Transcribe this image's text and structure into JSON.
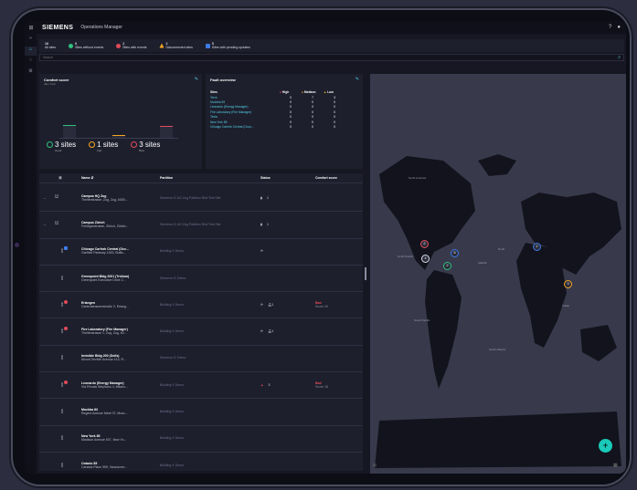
{
  "header": {
    "brand": "SIEMENS",
    "app_title": "Operations Manager"
  },
  "summary": [
    {
      "count": "16",
      "label": "All sites",
      "color": "#dcdcea",
      "icon": "all"
    },
    {
      "count": "6",
      "label": "Sites without events",
      "color": "#2ec27e",
      "icon": "check"
    },
    {
      "count": "2",
      "label": "Sites with events",
      "color": "#e14b5a",
      "icon": "alert"
    },
    {
      "count": "2",
      "label": "Disconnected sites",
      "color": "#f5a623",
      "icon": "warn"
    },
    {
      "count": "5",
      "label": "Sites with pending updates",
      "color": "#3f7be8",
      "icon": "update"
    }
  ],
  "search": {
    "placeholder": "Search"
  },
  "comfort": {
    "title": "Comfort score",
    "subtitle": "Jan / Feb",
    "kpis": [
      {
        "value": "3 sites",
        "label": "Good",
        "color": "#2ec27e",
        "level": 0.55
      },
      {
        "value": "1 sites",
        "label": "Fair",
        "color": "#f5a623",
        "level": 0.1
      },
      {
        "value": "3 sites",
        "label": "Bad",
        "color": "#e14b5a",
        "level": 0.5
      }
    ]
  },
  "fault": {
    "title": "Fault overview",
    "col_sites": "Sites",
    "col_high": "High",
    "col_medium": "Medium",
    "col_low": "Low",
    "rows": [
      {
        "site": "Terra",
        "high": "0",
        "medium": "7",
        "low": "3"
      },
      {
        "site": "Mockba 83",
        "high": "0",
        "medium": "0",
        "low": "0"
      },
      {
        "site": "Leonardo (Energy Manager)",
        "high": "0",
        "medium": "0",
        "low": "0"
      },
      {
        "site": "Fire Laboratory (Fire Manager)",
        "high": "0",
        "medium": "0",
        "low": "0"
      },
      {
        "site": "Tesla",
        "high": "0",
        "medium": "0",
        "low": "0"
      },
      {
        "site": "New York 85",
        "high": "0",
        "medium": "0",
        "low": "0"
      },
      {
        "site": "Chicago Carfork Central (Occu...",
        "high": "0",
        "medium": "0",
        "low": "0"
      }
    ]
  },
  "table": {
    "col_name": "Name",
    "col_partition": "Partition",
    "col_status": "Status",
    "col_comfort": "Comfort score",
    "rows": [
      {
        "name": "Campus HQ Zug",
        "addr": "Theilerstrasse, Zug, Zug, 6300...",
        "partition": "Siemens IC AG Zug Partition Red Test Site",
        "status": "1",
        "comfort": "",
        "comfort_sub": "",
        "badge": ""
      },
      {
        "name": "Campus Zürich",
        "addr": "Freilagerstrasse, Zürich, Zürich...",
        "partition": "Siemens IC AG Zug Partition Red Test Site",
        "status": "1",
        "comfort": "",
        "comfort_sub": "",
        "badge": ""
      },
      {
        "name": "Chicago Carfork Central (Occ...",
        "addr": "Garfield Parkway 1000, Buffa...",
        "partition": "Building X Demo",
        "status": "sync",
        "comfort": "",
        "comfort_sub": "",
        "badge": "blue"
      },
      {
        "name": "Greenpoint Bldg 2001 (Tridium)",
        "addr": "Greenpoint Executive Drive 2...",
        "partition": "Siemens IC Demo",
        "status": "",
        "comfort": "",
        "comfort_sub": "",
        "badge": ""
      },
      {
        "name": "Erlangen",
        "addr": "Gartenstrassenstraße 2, Erlang...",
        "partition": "Building X Demo",
        "status": "sync  1",
        "comfort": "Bad",
        "comfort_sub": "Score 20",
        "badge": "red"
      },
      {
        "name": "Fire Laboratory (Fire Manager)",
        "addr": "Theilerstrasse 1, Zug, Zug, 63...",
        "partition": "Building X Demo",
        "status": "sync  1",
        "comfort": "",
        "comfort_sub": "",
        "badge": "red"
      },
      {
        "name": "Invisible Bldg 200 (Dolls)",
        "addr": "Mount Terrible Avenue 413, R...",
        "partition": "Siemens IC Demo",
        "status": "",
        "comfort": "",
        "comfort_sub": "",
        "badge": ""
      },
      {
        "name": "Leonardo (Energy Manager)",
        "addr": "Via Privata Stephano 4, Milano...",
        "partition": "Building X Demo",
        "status": "3",
        "comfort": "Bad",
        "comfort_sub": "Score 18",
        "badge": "red"
      },
      {
        "name": "Mockba 83",
        "addr": "Regent Avenue Meet 37, Mosc...",
        "partition": "Building X Demo",
        "status": "",
        "comfort": "",
        "comfort_sub": "",
        "badge": ""
      },
      {
        "name": "New York 85",
        "addr": "Madison Avenue 507, New Yo...",
        "partition": "Building X Demo",
        "status": "",
        "comfort": "",
        "comfort_sub": "",
        "badge": ""
      },
      {
        "name": "Ontario 85",
        "addr": "Canada Place 999, Vancouver...",
        "partition": "Building X Demo",
        "status": "",
        "comfort": "",
        "comfort_sub": "",
        "badge": ""
      }
    ]
  },
  "map": {
    "markers": [
      {
        "label": "2",
        "color": "#e14b5a"
      },
      {
        "label": "5",
        "color": "#3f7be8"
      },
      {
        "label": "4",
        "color": "#dcdcea"
      },
      {
        "label": "2",
        "color": "#2ec27e"
      },
      {
        "label": "2",
        "color": "#3f7be8"
      },
      {
        "label": "3",
        "color": "#f5a623"
      }
    ],
    "fab_label": "+"
  }
}
